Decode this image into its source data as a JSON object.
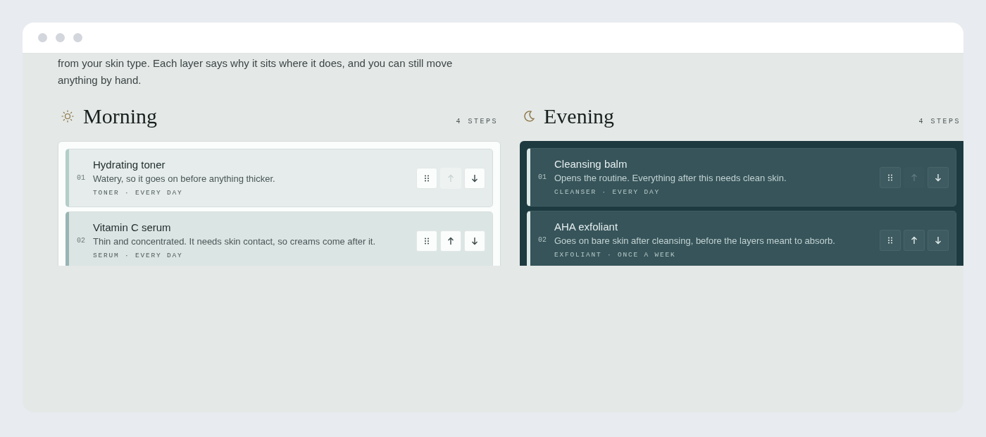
{
  "intro": "from your skin type. Each layer says why it sits where it does, and you can still move anything by hand.",
  "routines": [
    {
      "kind": "morning",
      "title": "Morning",
      "count": "4 STEPS",
      "steps": [
        {
          "number": "01",
          "name": "Hydrating toner",
          "reason": "Watery, so it goes on before anything thicker.",
          "meta": "TONER · EVERY DAY",
          "up_disabled": true
        },
        {
          "number": "02",
          "name": "Vitamin C serum",
          "reason": "Thin and concentrated. It needs skin contact, so creams come after it.",
          "meta": "SERUM · EVERY DAY",
          "up_disabled": false
        }
      ]
    },
    {
      "kind": "evening",
      "title": "Evening",
      "count": "4 STEPS",
      "steps": [
        {
          "number": "01",
          "name": "Cleansing balm",
          "reason": "Opens the routine. Everything after this needs clean skin.",
          "meta": "CLEANSER · EVERY DAY",
          "up_disabled": true
        },
        {
          "number": "02",
          "name": "AHA exfoliant",
          "reason": "Goes on bare skin after cleansing, before the layers meant to absorb.",
          "meta": "EXFOLIANT · ONCE A WEEK",
          "up_disabled": false
        }
      ]
    }
  ]
}
